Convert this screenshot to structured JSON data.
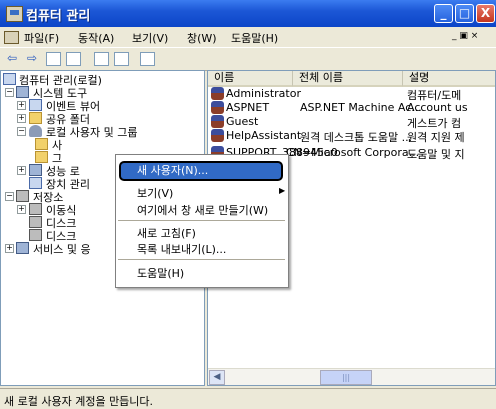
{
  "window": {
    "title": "컴퓨터 관리",
    "controls": {
      "minimize": "_",
      "maximize": "□",
      "close": "X"
    }
  },
  "menubar": {
    "items": [
      "파일(F)",
      "동작(A)",
      "보기(V)",
      "창(W)",
      "도움말(H)"
    ],
    "right": "_ ▣ ×"
  },
  "toolbar": {
    "back": "⇦",
    "forward": "⇨"
  },
  "tree": {
    "root": "컴퓨터 관리(로컬)",
    "system_tools": "시스템 도구",
    "event_viewer": "이벤트 뷰어",
    "shared_folders": "공유 폴더",
    "local_users_groups": "로컬 사용자 및 그룹",
    "users_partial": "사",
    "groups_partial": "그",
    "perf_partial": "성능 로",
    "devmgr_partial": "장치 관리",
    "storage": "저장소",
    "removable_partial": "이동식 ",
    "disk1_partial": "디스크 ",
    "disk2_partial": "디스크 ",
    "services_partial": "서비스 및 응"
  },
  "list": {
    "columns": [
      "이름",
      "전체 이름",
      "설명"
    ],
    "rows": [
      {
        "name": "Administrator",
        "full": "",
        "desc": "컴퓨터/도메"
      },
      {
        "name": "ASPNET",
        "full": "ASP.NET Machine Ac...",
        "desc": "Account us"
      },
      {
        "name": "Guest",
        "full": "",
        "desc": "게스트가 컴"
      },
      {
        "name": "HelpAssistant",
        "full": "원격 데스크톱 도움말 ...",
        "desc": "원격 지원 제"
      },
      {
        "name": "SUPPORT_388945a0",
        "full": "CN=Microsoft Corpora...",
        "desc": "도움말 및 지"
      }
    ]
  },
  "context_menu": {
    "new_user": "새 사용자(N)...",
    "view": "보기(V)",
    "new_window": "여기에서 창 새로 만들기(W)",
    "refresh": "새로 고침(F)",
    "export": "목록 내보내기(L)...",
    "help": "도움말(H)"
  },
  "status": {
    "text": "새 로컬 사용자 계정을 만듭니다."
  }
}
